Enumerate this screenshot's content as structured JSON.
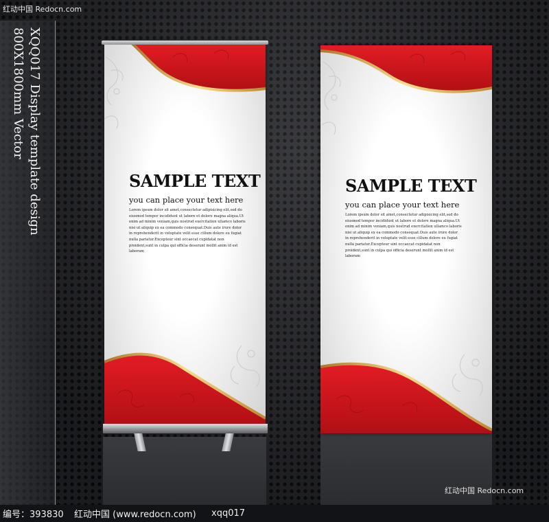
{
  "watermark_top": "红动中国 Redocn.com",
  "watermark_corner": "红动中国 Redocn.com",
  "side": {
    "line1": "XQQ017 Display template design",
    "line2": "800X1800mm Vector"
  },
  "banners": [
    {
      "title": "SAMPLE TEXT",
      "subtitle": "you can place your text here",
      "body": "Lorem ipsum dolor sit amet,consectetur adipisicing elit,sed do eiusmod tempor incididunt ut labore et dolore magna aliqua.Ut enim ad minim veniam,quis nostrud exercitation ullamco laboris nisi ut aliquip ex ea commodo consequat.Duis aute irure dolor in reprehenderit in voluptate velit esse cillum dolore eu fugiat nulla pariatur.Excepteur sint occaecat cupidatat non proident,sunt in culpa qui officia deserunt mollit anim id est laborum"
    },
    {
      "title": "SAMPLE TEXT",
      "subtitle": "you can place your text here",
      "body": "Lorem ipsum dolor sit amet,consectetur adipisicing elit,sed do eiusmod tempor incididunt ut labore et dolore magna aliqua.Ut enim ad minim veniam,quis nostrud exercitation ullamco laboris nisi ut aliquip ex ea commodo consequat.Duis aute irure dolor in reprehenderit in voluptate velit esse cillum dolore eu fugiat nulla pariatur.Excepteur sint occaecat cupidatat non proident,sunt in culpa qui officia deserunt mollit anim id est laborum"
    }
  ],
  "footer": {
    "code": "编号：393830",
    "site": "红动中国 (www.redocn.com)",
    "id": "xqq017"
  },
  "colors": {
    "red": "#d4121a",
    "dark_red": "#a80d12",
    "gold": "#d6ad4c",
    "background": "#232428"
  }
}
